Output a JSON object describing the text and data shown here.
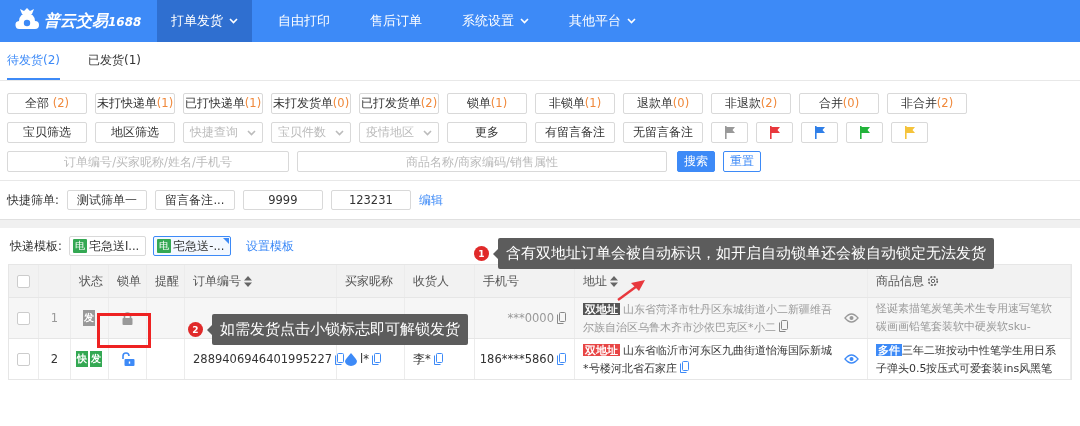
{
  "logo": {
    "name": "普云交易",
    "suffix": "1688"
  },
  "nav": [
    {
      "label": "打单发货",
      "selected": true,
      "dropdown": true
    },
    {
      "label": "自由打印",
      "selected": false,
      "dropdown": false
    },
    {
      "label": "售后订单",
      "selected": false,
      "dropdown": false
    },
    {
      "label": "系统设置",
      "selected": false,
      "dropdown": true
    },
    {
      "label": "其他平台",
      "selected": false,
      "dropdown": true
    }
  ],
  "status_tabs": [
    {
      "label": "待发货(2)",
      "selected": true
    },
    {
      "label": "已发货(1)",
      "selected": false
    }
  ],
  "filter_row_1": [
    {
      "label": "全部",
      "count": " (2)"
    },
    {
      "label": "未打快递单",
      "count": "(1)"
    },
    {
      "label": "已打快递单",
      "count": "(1)"
    },
    {
      "label": "未打发货单",
      "count": "(0)"
    },
    {
      "label": "已打发货单",
      "count": "(2)"
    },
    {
      "label": "锁单",
      "count": "(1)"
    },
    {
      "label": "非锁单",
      "count": "(1)"
    },
    {
      "label": "退款单",
      "count": "(0)"
    },
    {
      "label": "非退款",
      "count": "(2)"
    },
    {
      "label": "合并",
      "count": "(0)"
    },
    {
      "label": "非合并",
      "count": "(2)"
    }
  ],
  "filter_row_2": [
    {
      "kind": "button",
      "label": "宝贝筛选"
    },
    {
      "kind": "button",
      "label": "地区筛选"
    },
    {
      "kind": "select",
      "placeholder": "快捷查询"
    },
    {
      "kind": "select",
      "placeholder": "宝贝件数"
    },
    {
      "kind": "select",
      "placeholder": "疫情地区"
    },
    {
      "kind": "button",
      "label": "更多"
    },
    {
      "kind": "button",
      "label": "有留言备注"
    },
    {
      "kind": "button",
      "label": "无留言备注"
    },
    {
      "kind": "flag",
      "color": "#999999"
    },
    {
      "kind": "flag",
      "color": "#e8383d"
    },
    {
      "kind": "flag",
      "color": "#2f7fe8"
    },
    {
      "kind": "flag",
      "color": "#22b33a"
    },
    {
      "kind": "flag",
      "color": "#f5c33a"
    }
  ],
  "search": {
    "order_placeholder": "订单编号/买家昵称/姓名/手机号",
    "goods_placeholder": "商品名称/商家编码/销售属性",
    "search_button": "搜索",
    "reset_button": "重置"
  },
  "quick_filter": {
    "label": "快捷筛单:",
    "items": [
      "测试筛单一",
      "留言备注...",
      "9999",
      "123231"
    ],
    "edit_link": "编辑"
  },
  "templates": {
    "label": "快递模板:",
    "items": [
      {
        "badge": "电",
        "name": "宅急送I...",
        "selected": false
      },
      {
        "badge": "电",
        "name": "宅急送-...",
        "selected": true
      }
    ],
    "setup_link": "设置模板"
  },
  "table": {
    "columns": [
      {
        "kind": "checkbox",
        "checked": false
      },
      {
        "kind": "index"
      },
      {
        "label": "状态",
        "kind": "text"
      },
      {
        "label": "锁单",
        "kind": "text"
      },
      {
        "label": "提醒",
        "kind": "text"
      },
      {
        "label": "订单编号",
        "kind": "sort"
      },
      {
        "label": "买家昵称",
        "kind": "text"
      },
      {
        "label": "收货人",
        "kind": "text"
      },
      {
        "label": "手机号",
        "kind": "text"
      },
      {
        "label": "地址",
        "kind": "sort"
      },
      {
        "label": "商品信息",
        "kind": "settings"
      }
    ],
    "rows": [
      {
        "index": "1",
        "checked": false,
        "locked": true,
        "tags": [
          "发"
        ],
        "order_no": "",
        "buyer": "",
        "receiver": "",
        "phone": "***0000",
        "address_tag": "双地址",
        "address": "山东省菏泽市牡丹区东城街道小二新疆维吾尔族自治区乌鲁木齐市沙依巴克区*小二",
        "goods_tag": "",
        "goods": "怪诞素描笔炭笔美术生专用速写笔软碳画画铅笔套装软中硬炭软sku-"
      },
      {
        "index": "2",
        "checked": false,
        "locked": false,
        "tags": [
          "快",
          "发"
        ],
        "order_no": "2889406946401995227",
        "buyer": "l*",
        "receiver": "李*",
        "phone": "186****5860",
        "address_tag": "双地址",
        "address": "山东省临沂市河东区九曲街道怡海国际新城*号楼河北省石家庄",
        "goods_tag": "多件",
        "goods": "三年二班按动中性笔学生用日系子弹头0.5按压式可爱套装ins风黑笔"
      }
    ]
  },
  "tooltips": [
    {
      "number": "1",
      "text": "含有双地址订单会被自动标识，如开启自动锁单还会被自动锁定无法发货"
    },
    {
      "number": "2",
      "text": "如需发货点击小锁标志即可解锁发货"
    }
  ]
}
